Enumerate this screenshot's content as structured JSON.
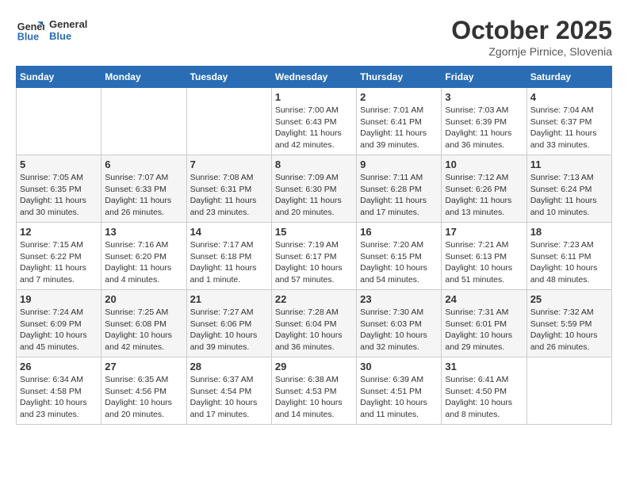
{
  "logo": {
    "line1": "General",
    "line2": "Blue"
  },
  "title": "October 2025",
  "subtitle": "Zgornje Pirnice, Slovenia",
  "weekdays": [
    "Sunday",
    "Monday",
    "Tuesday",
    "Wednesday",
    "Thursday",
    "Friday",
    "Saturday"
  ],
  "weeks": [
    [
      {
        "day": "",
        "info": ""
      },
      {
        "day": "",
        "info": ""
      },
      {
        "day": "",
        "info": ""
      },
      {
        "day": "1",
        "info": "Sunrise: 7:00 AM\nSunset: 6:43 PM\nDaylight: 11 hours\nand 42 minutes."
      },
      {
        "day": "2",
        "info": "Sunrise: 7:01 AM\nSunset: 6:41 PM\nDaylight: 11 hours\nand 39 minutes."
      },
      {
        "day": "3",
        "info": "Sunrise: 7:03 AM\nSunset: 6:39 PM\nDaylight: 11 hours\nand 36 minutes."
      },
      {
        "day": "4",
        "info": "Sunrise: 7:04 AM\nSunset: 6:37 PM\nDaylight: 11 hours\nand 33 minutes."
      }
    ],
    [
      {
        "day": "5",
        "info": "Sunrise: 7:05 AM\nSunset: 6:35 PM\nDaylight: 11 hours\nand 30 minutes."
      },
      {
        "day": "6",
        "info": "Sunrise: 7:07 AM\nSunset: 6:33 PM\nDaylight: 11 hours\nand 26 minutes."
      },
      {
        "day": "7",
        "info": "Sunrise: 7:08 AM\nSunset: 6:31 PM\nDaylight: 11 hours\nand 23 minutes."
      },
      {
        "day": "8",
        "info": "Sunrise: 7:09 AM\nSunset: 6:30 PM\nDaylight: 11 hours\nand 20 minutes."
      },
      {
        "day": "9",
        "info": "Sunrise: 7:11 AM\nSunset: 6:28 PM\nDaylight: 11 hours\nand 17 minutes."
      },
      {
        "day": "10",
        "info": "Sunrise: 7:12 AM\nSunset: 6:26 PM\nDaylight: 11 hours\nand 13 minutes."
      },
      {
        "day": "11",
        "info": "Sunrise: 7:13 AM\nSunset: 6:24 PM\nDaylight: 11 hours\nand 10 minutes."
      }
    ],
    [
      {
        "day": "12",
        "info": "Sunrise: 7:15 AM\nSunset: 6:22 PM\nDaylight: 11 hours\nand 7 minutes."
      },
      {
        "day": "13",
        "info": "Sunrise: 7:16 AM\nSunset: 6:20 PM\nDaylight: 11 hours\nand 4 minutes."
      },
      {
        "day": "14",
        "info": "Sunrise: 7:17 AM\nSunset: 6:18 PM\nDaylight: 11 hours\nand 1 minute."
      },
      {
        "day": "15",
        "info": "Sunrise: 7:19 AM\nSunset: 6:17 PM\nDaylight: 10 hours\nand 57 minutes."
      },
      {
        "day": "16",
        "info": "Sunrise: 7:20 AM\nSunset: 6:15 PM\nDaylight: 10 hours\nand 54 minutes."
      },
      {
        "day": "17",
        "info": "Sunrise: 7:21 AM\nSunset: 6:13 PM\nDaylight: 10 hours\nand 51 minutes."
      },
      {
        "day": "18",
        "info": "Sunrise: 7:23 AM\nSunset: 6:11 PM\nDaylight: 10 hours\nand 48 minutes."
      }
    ],
    [
      {
        "day": "19",
        "info": "Sunrise: 7:24 AM\nSunset: 6:09 PM\nDaylight: 10 hours\nand 45 minutes."
      },
      {
        "day": "20",
        "info": "Sunrise: 7:25 AM\nSunset: 6:08 PM\nDaylight: 10 hours\nand 42 minutes."
      },
      {
        "day": "21",
        "info": "Sunrise: 7:27 AM\nSunset: 6:06 PM\nDaylight: 10 hours\nand 39 minutes."
      },
      {
        "day": "22",
        "info": "Sunrise: 7:28 AM\nSunset: 6:04 PM\nDaylight: 10 hours\nand 36 minutes."
      },
      {
        "day": "23",
        "info": "Sunrise: 7:30 AM\nSunset: 6:03 PM\nDaylight: 10 hours\nand 32 minutes."
      },
      {
        "day": "24",
        "info": "Sunrise: 7:31 AM\nSunset: 6:01 PM\nDaylight: 10 hours\nand 29 minutes."
      },
      {
        "day": "25",
        "info": "Sunrise: 7:32 AM\nSunset: 5:59 PM\nDaylight: 10 hours\nand 26 minutes."
      }
    ],
    [
      {
        "day": "26",
        "info": "Sunrise: 6:34 AM\nSunset: 4:58 PM\nDaylight: 10 hours\nand 23 minutes."
      },
      {
        "day": "27",
        "info": "Sunrise: 6:35 AM\nSunset: 4:56 PM\nDaylight: 10 hours\nand 20 minutes."
      },
      {
        "day": "28",
        "info": "Sunrise: 6:37 AM\nSunset: 4:54 PM\nDaylight: 10 hours\nand 17 minutes."
      },
      {
        "day": "29",
        "info": "Sunrise: 6:38 AM\nSunset: 4:53 PM\nDaylight: 10 hours\nand 14 minutes."
      },
      {
        "day": "30",
        "info": "Sunrise: 6:39 AM\nSunset: 4:51 PM\nDaylight: 10 hours\nand 11 minutes."
      },
      {
        "day": "31",
        "info": "Sunrise: 6:41 AM\nSunset: 4:50 PM\nDaylight: 10 hours\nand 8 minutes."
      },
      {
        "day": "",
        "info": ""
      }
    ]
  ]
}
